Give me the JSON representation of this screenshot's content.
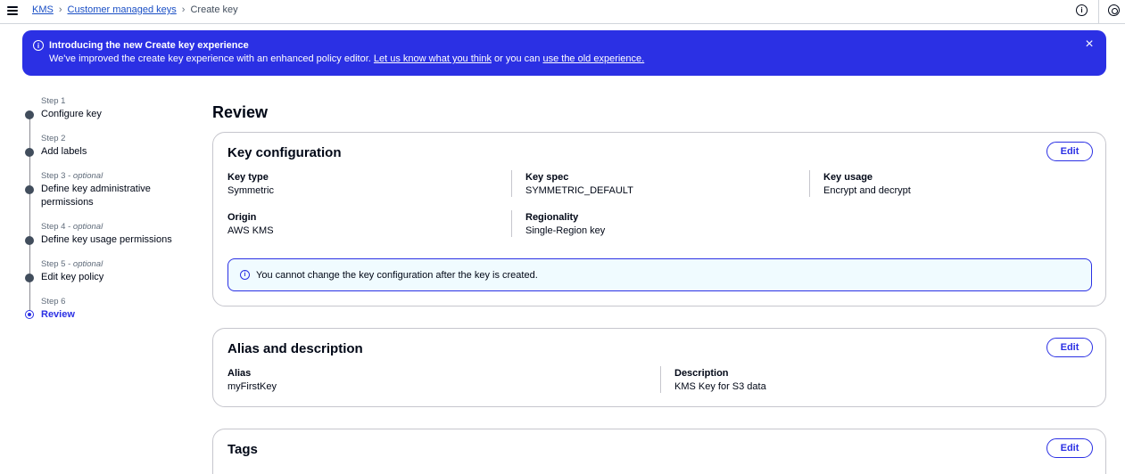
{
  "breadcrumb": {
    "items": [
      "KMS",
      "Customer managed keys"
    ],
    "current": "Create key",
    "separator": "›"
  },
  "flash": {
    "title": "Introducing the new Create key experience",
    "body_prefix": "We've improved the create key experience with an enhanced policy editor.",
    "link1": "Let us know what you think",
    "middle": "or you can",
    "link2": "use the old experience.",
    "close": "×",
    "icon_glyph": "i"
  },
  "steps": [
    {
      "num": "Step 1",
      "optional": "",
      "label": "Configure key"
    },
    {
      "num": "Step 2",
      "optional": "",
      "label": "Add labels"
    },
    {
      "num": "Step 3 - ",
      "optional": "optional",
      "label": "Define key administrative permissions"
    },
    {
      "num": "Step 4 - ",
      "optional": "optional",
      "label": "Define key usage permissions"
    },
    {
      "num": "Step 5 - ",
      "optional": "optional",
      "label": "Edit key policy"
    },
    {
      "num": "Step 6",
      "optional": "",
      "label": "Review"
    }
  ],
  "page_title": "Review",
  "key_config": {
    "title": "Key configuration",
    "edit": "Edit",
    "key_type_label": "Key type",
    "key_type_value": "Symmetric",
    "key_spec_label": "Key spec",
    "key_spec_value": "SYMMETRIC_DEFAULT",
    "key_usage_label": "Key usage",
    "key_usage_value": "Encrypt and decrypt",
    "origin_label": "Origin",
    "origin_value": "AWS KMS",
    "regionality_label": "Regionality",
    "regionality_value": "Single-Region key",
    "alert": "You cannot change the key configuration after the key is created."
  },
  "alias_desc": {
    "title": "Alias and description",
    "edit": "Edit",
    "alias_label": "Alias",
    "alias_value": "myFirstKey",
    "description_label": "Description",
    "description_value": "KMS Key for S3 data"
  },
  "tags": {
    "title": "Tags",
    "edit": "Edit"
  },
  "colors": {
    "accent": "#2b30e4",
    "text": "#000716",
    "border": "#c6c6cd",
    "alert_bg": "#f0fbff"
  }
}
